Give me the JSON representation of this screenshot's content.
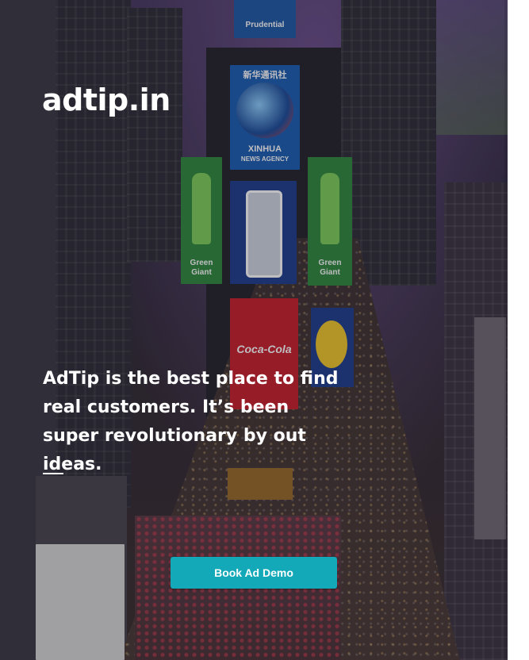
{
  "brand": {
    "logo_text": "adtip.in"
  },
  "hero": {
    "tagline": "AdTip is the best place to find real customers. It’s been super revolutionary by out ideas.",
    "cta_label": "Book Ad Demo"
  },
  "signs": {
    "prudential": "Prudential",
    "xinhua_cn": "新华通讯社",
    "xinhua_en": "XINHUA",
    "xinhua_sub": "NEWS AGENCY",
    "green_giant_1": "Green Giant",
    "green_giant_2": "Green Giant",
    "coca_cola": "Coca-Cola"
  },
  "colors": {
    "cta_background": "#14a9b8",
    "text": "#ffffff"
  }
}
